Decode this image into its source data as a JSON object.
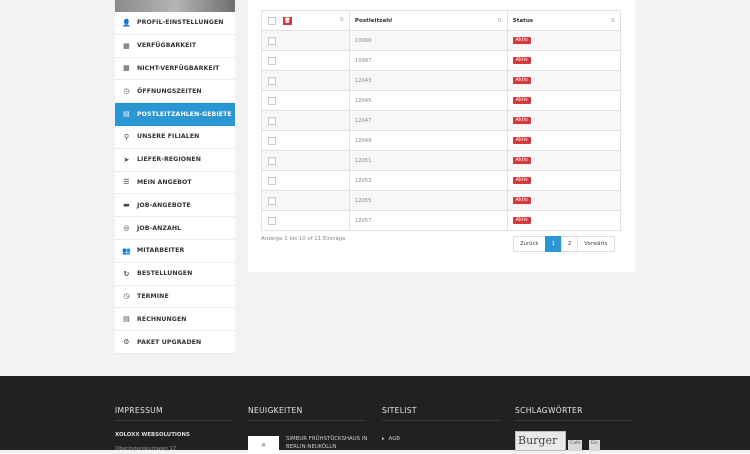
{
  "sidebar": {
    "items": [
      {
        "label": "PROFIL-EINSTELLUNGEN",
        "icon": "user-icon",
        "glyph": "👤",
        "active": false
      },
      {
        "label": "VERFÜGBARKEIT",
        "icon": "calendar-icon",
        "glyph": "▦",
        "active": false
      },
      {
        "label": "NICHT-VERFÜGBARKEIT",
        "icon": "calendar-icon",
        "glyph": "▦",
        "active": false
      },
      {
        "label": "ÖFFNUNGSZEITEN",
        "icon": "clock-icon",
        "glyph": "◷",
        "active": false
      },
      {
        "label": "POSTLEITZAHLEN-GEBIETE",
        "icon": "document-icon",
        "glyph": "▤",
        "active": true
      },
      {
        "label": "UNSERE FILIALEN",
        "icon": "map-marker-icon",
        "glyph": "⚲",
        "active": false
      },
      {
        "label": "LIEFER-REGIONEN",
        "icon": "location-arrow-icon",
        "glyph": "➤",
        "active": false
      },
      {
        "label": "MEIN ANGEBOT",
        "icon": "list-icon",
        "glyph": "☰",
        "active": false
      },
      {
        "label": "JOB-ANGEBOTE",
        "icon": "briefcase-icon",
        "glyph": "▬",
        "active": false
      },
      {
        "label": "JOB-ANZAHL",
        "icon": "target-icon",
        "glyph": "◎",
        "active": false
      },
      {
        "label": "MITARBEITER",
        "icon": "users-icon",
        "glyph": "👥",
        "active": false
      },
      {
        "label": "BESTELLUNGEN",
        "icon": "refresh-icon",
        "glyph": "↻",
        "active": false
      },
      {
        "label": "TERMINE",
        "icon": "clock-icon",
        "glyph": "◷",
        "active": false
      },
      {
        "label": "RECHNUNGEN",
        "icon": "file-icon",
        "glyph": "▤",
        "active": false
      },
      {
        "label": "PAKET UPGRADEN",
        "icon": "gear-icon",
        "glyph": "⚙",
        "active": false
      }
    ]
  },
  "table": {
    "headers": {
      "postleitzahl": "Postleitzahl",
      "status": "Status"
    },
    "rows": [
      {
        "plz": "10960",
        "status": "Aktiv"
      },
      {
        "plz": "10997",
        "status": "Aktiv"
      },
      {
        "plz": "12043",
        "status": "Aktiv"
      },
      {
        "plz": "12045",
        "status": "Aktiv"
      },
      {
        "plz": "12047",
        "status": "Aktiv"
      },
      {
        "plz": "12049",
        "status": "Aktiv"
      },
      {
        "plz": "12051",
        "status": "Aktiv"
      },
      {
        "plz": "12053",
        "status": "Aktiv"
      },
      {
        "plz": "12055",
        "status": "Aktiv"
      },
      {
        "plz": "12057",
        "status": "Aktiv"
      }
    ],
    "info": "Anzeige 1 bis 10 of 11 Einträge"
  },
  "pagination": {
    "prev": "Zurück",
    "pages": [
      "1",
      "2"
    ],
    "current": "1",
    "next": "Vorwärts"
  },
  "footer": {
    "impressum": {
      "heading": "IMPRESSUM",
      "company": "XOLOXX WEBSOLUTIONS",
      "address": "Oberingenieursweg 17"
    },
    "news": {
      "heading": "NEUIGKEITEN",
      "title": "SIMBUR FRÜHSTÜCKSHAUS IN BERLIN-NEUKÖLLN"
    },
    "sitelist": {
      "heading": "SITELIST",
      "link": "AGB"
    },
    "tags": {
      "heading": "SCHLAGWÖRTER",
      "big": "Burger",
      "small": [
        "Cafe",
        "Eis"
      ]
    }
  },
  "colors": {
    "accent": "#2a96d3",
    "danger": "#d9383a",
    "footer": "#212121"
  }
}
